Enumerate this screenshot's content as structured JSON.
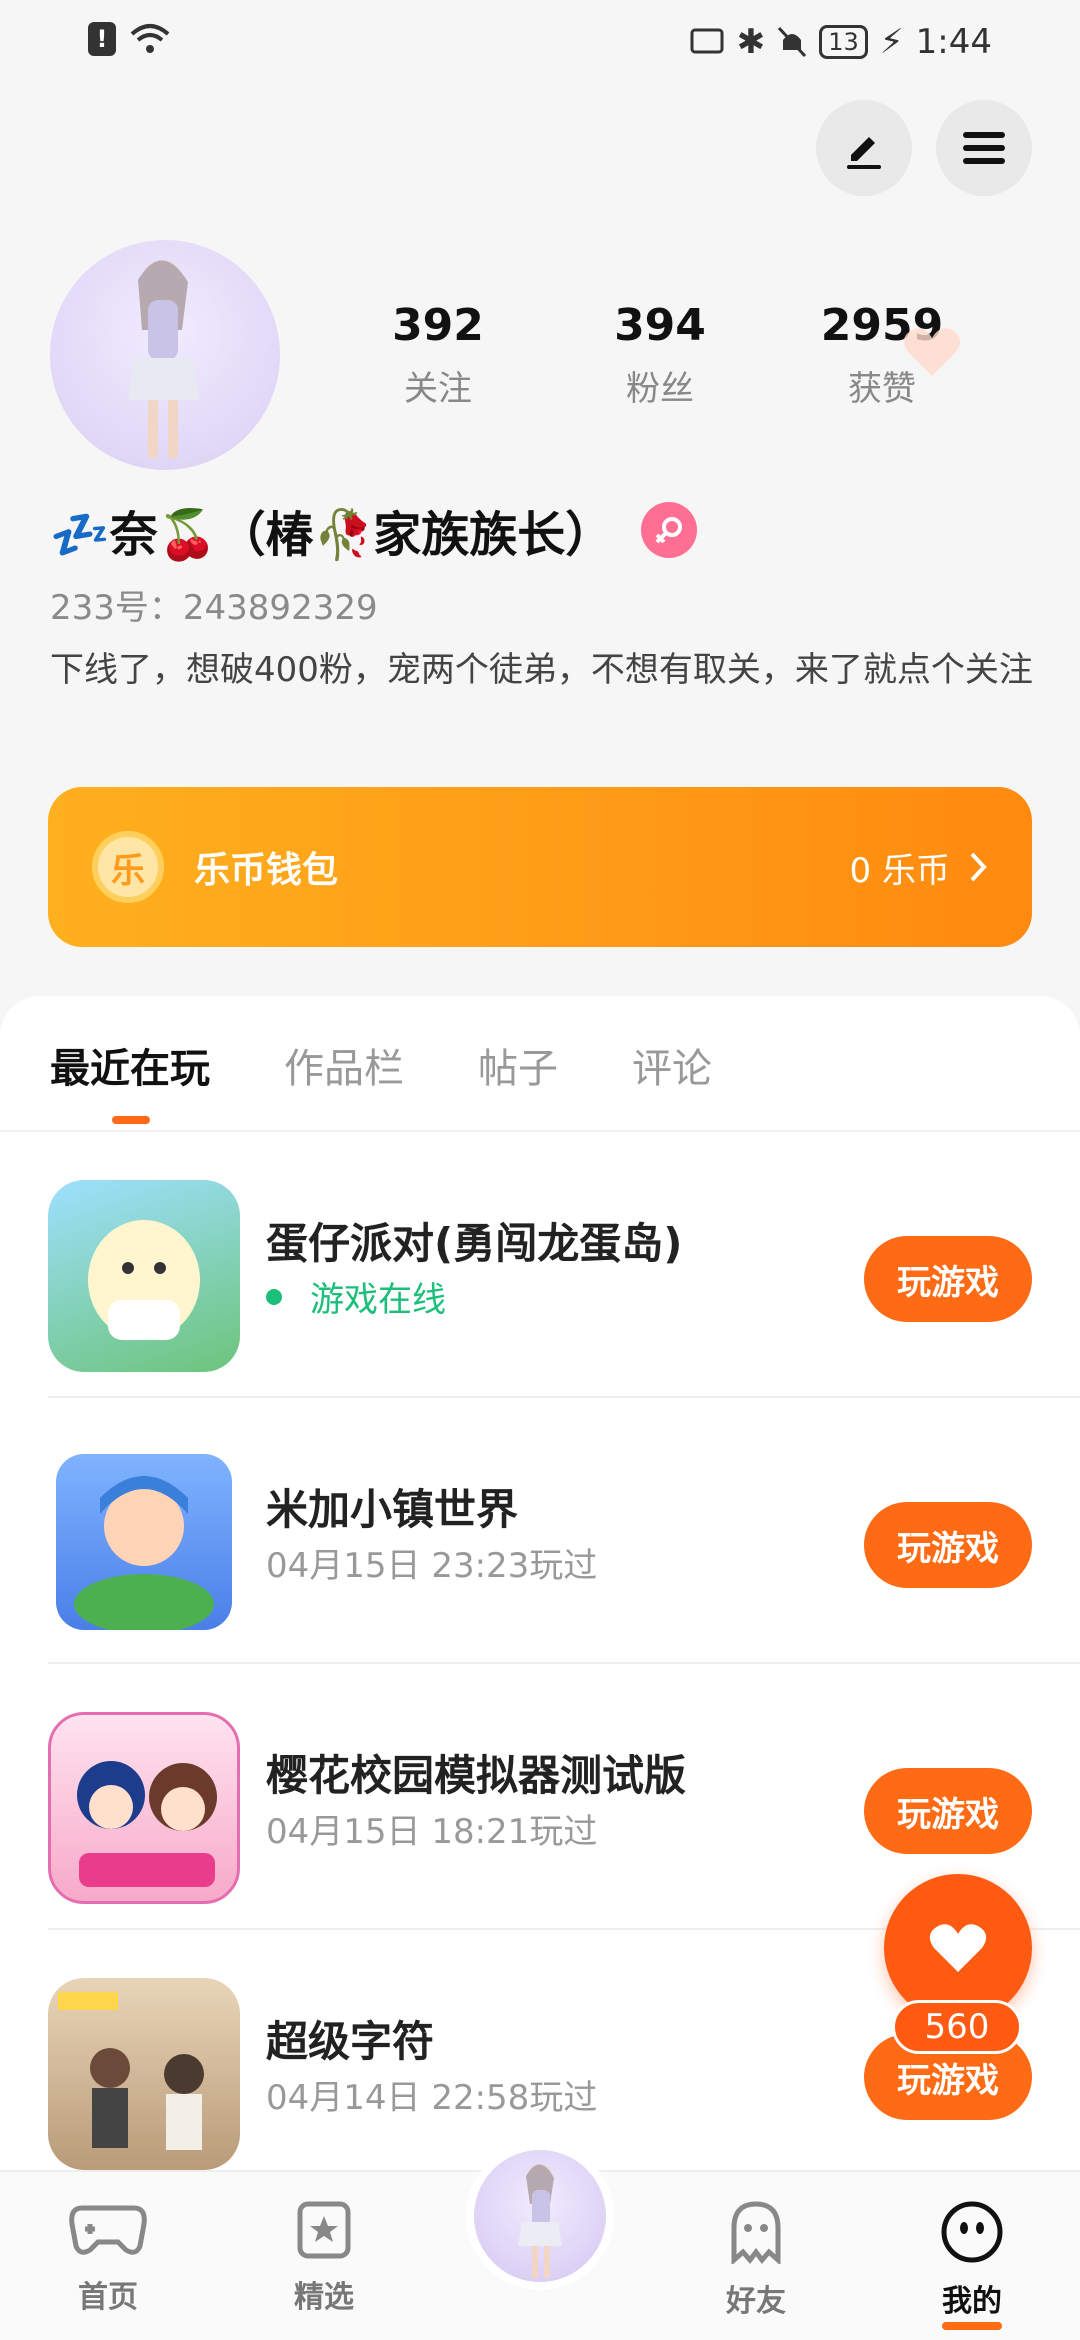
{
  "status_bar": {
    "time": "1:44",
    "battery": "13"
  },
  "profile": {
    "name": "💤奈🍒（椿🥀家族族长）",
    "uid_label": "233号：",
    "uid": "243892329",
    "bio": "下线了，想破400粉，宠两个徒弟，不想有取关，来了就点个关注",
    "stats": [
      {
        "value": "392",
        "label": "关注"
      },
      {
        "value": "394",
        "label": "粉丝"
      },
      {
        "value": "2959",
        "label": "获赞"
      }
    ]
  },
  "wallet": {
    "coin_glyph": "乐",
    "title": "乐币钱包",
    "amount": "0 乐币"
  },
  "tabs": [
    "最近在玩",
    "作品栏",
    "帖子",
    "评论"
  ],
  "games": [
    {
      "title": "蛋仔派对(勇闯龙蛋岛)",
      "sub": "游戏在线",
      "button": "玩游戏"
    },
    {
      "title": "米加小镇世界",
      "sub": "04月15日 23:23玩过",
      "button": "玩游戏"
    },
    {
      "title": "樱花校园模拟器测试版",
      "sub": "04月15日 18:21玩过",
      "button": "玩游戏"
    },
    {
      "title": "超级字符",
      "sub": "04月14日 22:58玩过",
      "button": "玩游戏"
    }
  ],
  "like_count": "560",
  "nav": [
    {
      "label": "首页"
    },
    {
      "label": "精选"
    },
    {
      "label": "好友"
    },
    {
      "label": "我的"
    }
  ],
  "colors": {
    "accent": "#ff6a14",
    "wallet_start": "#ffb01e",
    "wallet_end": "#ff8a10",
    "online": "#1bbf7a"
  }
}
